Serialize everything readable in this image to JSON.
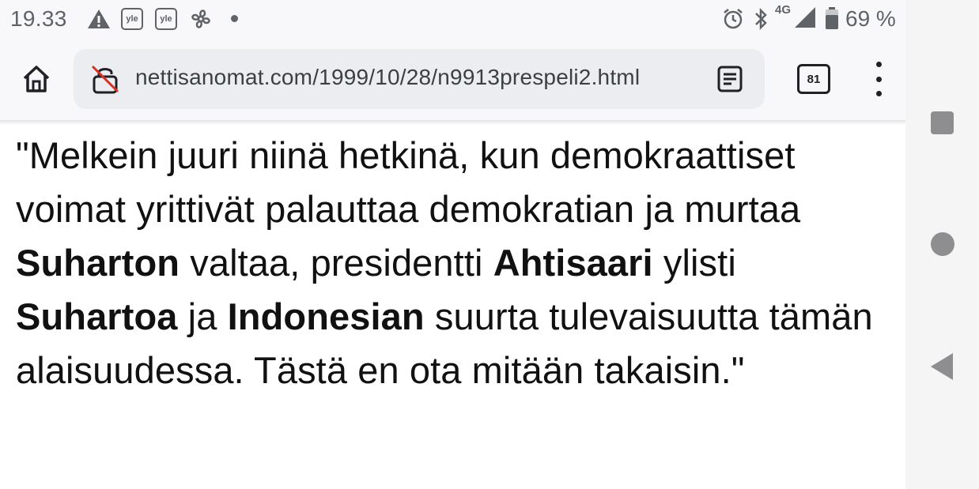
{
  "status_bar": {
    "time": "19.33",
    "notification_icons": [
      "warning-icon",
      "yle-icon",
      "yle-icon",
      "fan-icon",
      "dot-icon"
    ],
    "yle_label": "yle",
    "network_label": "4G",
    "battery_percent": "69 %",
    "system_icons": [
      "alarm-icon",
      "bluetooth-icon",
      "signal-icon",
      "battery-icon"
    ]
  },
  "toolbar": {
    "url": "nettisanomat.com/1999/10/28/n9913prespeli2.html",
    "tab_count": "81"
  },
  "article": {
    "t1": "\"Melkein juuri niinä hetkinä, kun demokraattiset voimat yrittivät palauttaa demokratian ja murtaa ",
    "b1": "Suharton",
    "t2": " valtaa, presidentti ",
    "b2": "Ahtisaari",
    "t3": " ylisti ",
    "b3": "Suhartoa",
    "t4": " ja ",
    "b4": "Indonesian",
    "t5": " suurta tulevaisuutta tämän alaisuudessa. Tästä en ota mitään takaisin.\""
  },
  "colors": {
    "toolbar_bg": "#f8f8fa",
    "urlbar_bg": "#ecedf1",
    "nav_icon": "#8e8e90",
    "lock_slash": "#d93025"
  }
}
